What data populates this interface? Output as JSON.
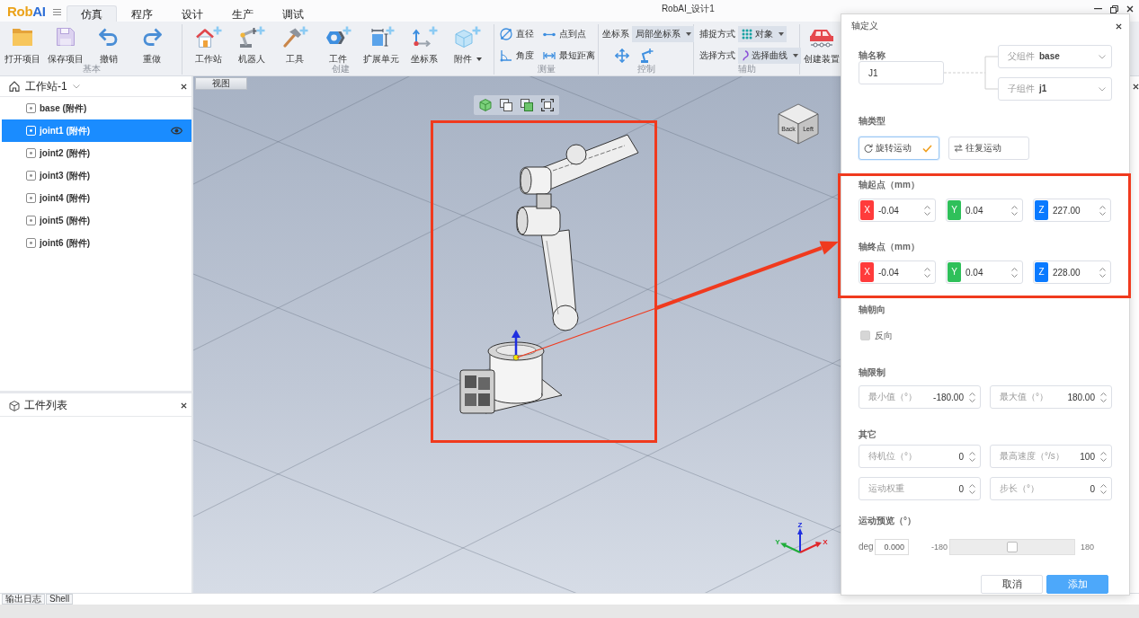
{
  "logo": [
    {
      "text": "Rob",
      "color": "#eba21a"
    },
    {
      "text": "AI",
      "color": "#2d6ed6"
    }
  ],
  "menu_tabs": [
    {
      "label": "仿真",
      "selected": true
    },
    {
      "label": "程序",
      "selected": false
    },
    {
      "label": "设计",
      "selected": false
    },
    {
      "label": "生产",
      "selected": false
    },
    {
      "label": "调试",
      "selected": false
    }
  ],
  "window": {
    "title": "RobAI_设计1"
  },
  "ribbon": {
    "groups": [
      {
        "label": "基本",
        "items": [
          {
            "kind": "large",
            "label": "打开项目"
          },
          {
            "kind": "large",
            "label": "保存项目"
          },
          {
            "kind": "large",
            "label": "撤销"
          },
          {
            "kind": "large",
            "label": "重做"
          }
        ]
      },
      {
        "label": "创建",
        "items": [
          {
            "kind": "large",
            "label": "工作站"
          },
          {
            "kind": "large",
            "label": "机器人"
          },
          {
            "kind": "large",
            "label": "工具"
          },
          {
            "kind": "large",
            "label": "工件"
          },
          {
            "kind": "large",
            "label": "扩展单元"
          },
          {
            "kind": "large",
            "label": "坐标系"
          },
          {
            "kind": "split",
            "label": "附件"
          }
        ]
      },
      {
        "label": "测量",
        "items": [
          {
            "kind": "small",
            "label": "直径"
          },
          {
            "kind": "small",
            "label": "点到点"
          },
          {
            "kind": "small",
            "label": "角度"
          },
          {
            "kind": "small",
            "label": "最短距离"
          }
        ]
      },
      {
        "label": "控制",
        "items": [
          {
            "kind": "select",
            "label": "坐标系",
            "value": "局部坐标系"
          },
          {
            "kind": "icon"
          },
          {
            "kind": "icon"
          }
        ]
      },
      {
        "label": "辅助",
        "items": [
          {
            "kind": "select",
            "label": "捕捉方式",
            "value": "对象"
          },
          {
            "kind": "select",
            "label": "选择方式",
            "value": "选择曲线"
          }
        ]
      },
      {
        "items": [
          {
            "kind": "large",
            "label": "创建装置"
          }
        ]
      }
    ]
  },
  "station_panel": {
    "title": "工作站-1",
    "items": [
      {
        "label": "base (附件)",
        "selected": false
      },
      {
        "label": "joint1 (附件)",
        "selected": true
      },
      {
        "label": "joint2 (附件)",
        "selected": false
      },
      {
        "label": "joint3 (附件)",
        "selected": false
      },
      {
        "label": "joint4 (附件)",
        "selected": false
      },
      {
        "label": "joint5 (附件)",
        "selected": false
      },
      {
        "label": "joint6 (附件)",
        "selected": false
      }
    ]
  },
  "parts_panel": {
    "title": "工件列表"
  },
  "viewport": {
    "tab": "视图",
    "view_cube_faces": [
      "Back",
      "Left"
    ],
    "axes": [
      {
        "label": "Z",
        "color": "#1f2ee0"
      },
      {
        "label": "Y",
        "color": "#1fae3a"
      },
      {
        "label": "X",
        "color": "#e0262a"
      }
    ]
  },
  "dialog": {
    "title": "轴定义",
    "axis_name": {
      "label": "轴名称",
      "value": "J1"
    },
    "parent_component": {
      "label": "父组件",
      "value": "base"
    },
    "child_component": {
      "label": "子组件",
      "value": "j1"
    },
    "axis_type": {
      "label": "轴类型",
      "options": [
        {
          "label": "旋转运动",
          "selected": true
        },
        {
          "label": "往复运动",
          "selected": false
        }
      ]
    },
    "start_point": {
      "label": "轴起点（mm）",
      "fields": [
        {
          "axis": "X",
          "color": "#ff3b3b",
          "value": "-0.04"
        },
        {
          "axis": "Y",
          "color": "#2fc05a",
          "value": "0.04"
        },
        {
          "axis": "Z",
          "color": "#0a7aff",
          "value": "227.00"
        }
      ]
    },
    "end_point": {
      "label": "轴终点（mm）",
      "fields": [
        {
          "axis": "X",
          "color": "#ff3b3b",
          "value": "-0.04"
        },
        {
          "axis": "Y",
          "color": "#2fc05a",
          "value": "0.04"
        },
        {
          "axis": "Z",
          "color": "#0a7aff",
          "value": "228.00"
        }
      ]
    },
    "direction": {
      "label": "轴朝向",
      "checkbox": {
        "label": "反向",
        "checked": false,
        "disabled": true
      }
    },
    "limits": {
      "label": "轴限制",
      "fields": [
        {
          "label": "最小值（°）",
          "value": "-180.00"
        },
        {
          "label": "最大值（°）",
          "value": "180.00"
        }
      ]
    },
    "other": {
      "label": "其它",
      "fields": [
        {
          "label": "待机位（°）",
          "value": "0"
        },
        {
          "label": "最高速度（°/s）",
          "value": "100"
        },
        {
          "label": "运动权重",
          "value": "0"
        },
        {
          "label": "步长（°）",
          "value": "0"
        }
      ]
    },
    "preview": {
      "label": "运动预览（°）",
      "unit": "deg",
      "value": "0.000",
      "min": "-180",
      "max": "180",
      "level": 0.5
    },
    "buttons": [
      {
        "label": "取消",
        "kind": "secondary"
      },
      {
        "label": "添加",
        "kind": "primary"
      }
    ]
  },
  "bottom_tabs": [
    "输出日志",
    "Shell"
  ]
}
